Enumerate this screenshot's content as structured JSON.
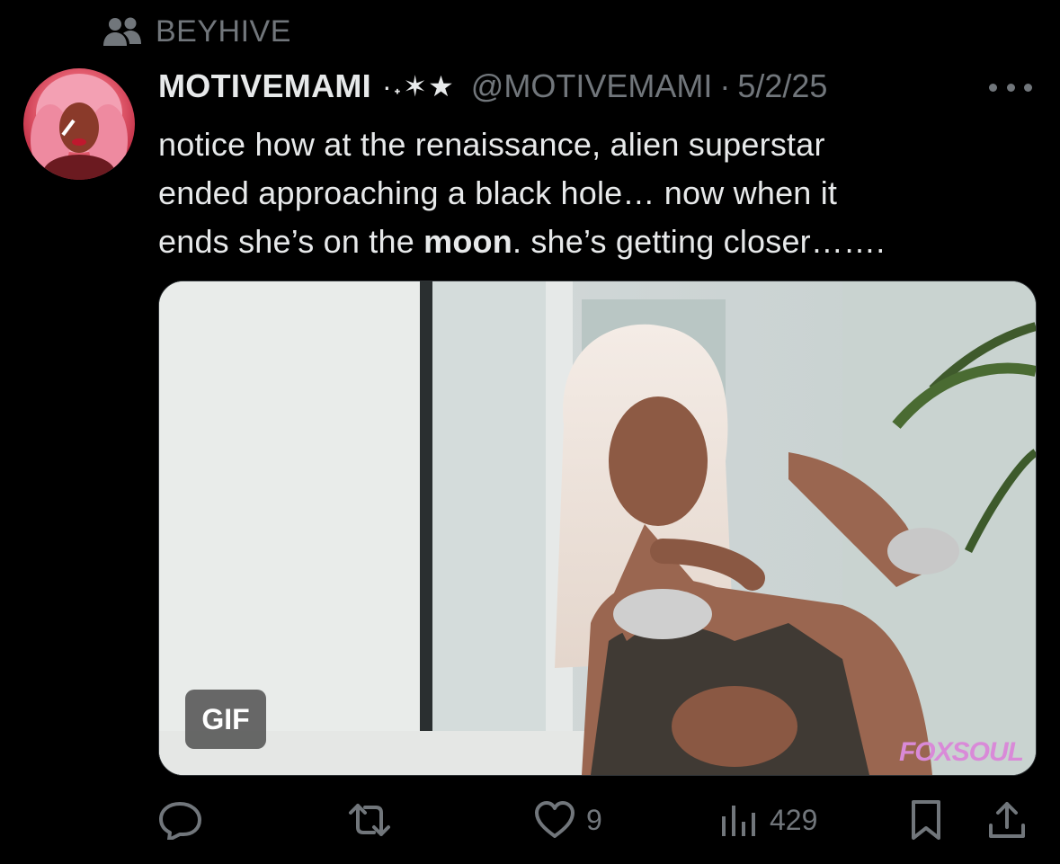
{
  "community": {
    "label": "BEYHIVE",
    "icon": "community-people-icon"
  },
  "tweet": {
    "display_name": "MOTIVEMAMI",
    "name_emoji": "·˖✶★",
    "handle": "@MOTIVEMAMI",
    "separator": "·",
    "date": "5/2/25",
    "text_line1": "notice how at the renaissance, alien superstar",
    "text_line2": "ended approaching a black hole… now when it",
    "text_line3_before": "ends she’s on the ",
    "text_line3_bold": "moon",
    "text_line3_after": ". she’s getting closer…….",
    "media": {
      "badge": "GIF",
      "watermark": "FOXSOUL"
    }
  },
  "actions": {
    "reply_count": "",
    "retweet_count": "",
    "like_count": "9",
    "views_count": "429"
  },
  "colors": {
    "background": "#000000",
    "text": "#e7e9ea",
    "muted": "#71767b"
  }
}
